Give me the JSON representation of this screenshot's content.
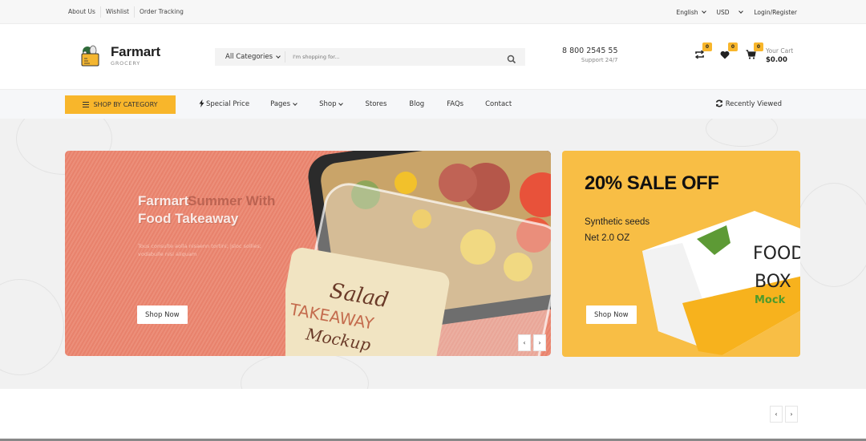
{
  "topbar": {
    "links": [
      "About Us",
      "Wishlist",
      "Order Tracking"
    ],
    "language": "English",
    "currency": "USD",
    "account": "Login/Register"
  },
  "header": {
    "brand": "Farmart",
    "tagline": "GROCERY",
    "search": {
      "category": "All Categories",
      "placeholder": "I'm shopping for..."
    },
    "phone": "8 800 2545 55",
    "support": "Support 24/7",
    "compare_count": "0",
    "wishlist_count": "0",
    "cart_count": "0",
    "cart_label": "Your Cart",
    "cart_total": "$0.00"
  },
  "nav": {
    "shop_by_category": "SHOP BY CATEGORY",
    "items": [
      {
        "label": "Special Price",
        "icon": "bolt-icon",
        "dropdown": false
      },
      {
        "label": "Pages",
        "dropdown": true
      },
      {
        "label": "Shop",
        "dropdown": true
      },
      {
        "label": "Stores",
        "dropdown": false
      },
      {
        "label": "Blog",
        "dropdown": false
      },
      {
        "label": "FAQs",
        "dropdown": false
      },
      {
        "label": "Contact",
        "dropdown": false
      }
    ],
    "recently_viewed": "Recently Viewed"
  },
  "hero": {
    "slide": {
      "title_line1": "Farmart",
      "title_line2": "Food Takeaway",
      "ghost_line1": "Summer With",
      "ghost_line2": "",
      "description": "Tous consulte aolla nisaenn tortini; jsloc sollies; vodabulle nisi aliquam",
      "button": "Shop Now",
      "prev": "‹",
      "next": "›",
      "image_labels": {
        "label_script": "Salad",
        "label_main": "TAKEAWAY",
        "label_sub": "Mockup"
      }
    },
    "promo": {
      "title": "20% SALE OFF",
      "subtitle_line1": "Synthetic seeds",
      "subtitle_line2": "Net 2.0 OZ",
      "button": "Shop Now",
      "box_text": [
        "FOOD",
        "BOX",
        "Mock"
      ]
    }
  },
  "bottom": {
    "prev": "‹",
    "next": "›"
  },
  "colors": {
    "accent": "#f8b62b",
    "slide_bg": "#ec8f7a",
    "promo_bg": "#f8be45",
    "nav_bg": "#f6f7f9"
  }
}
